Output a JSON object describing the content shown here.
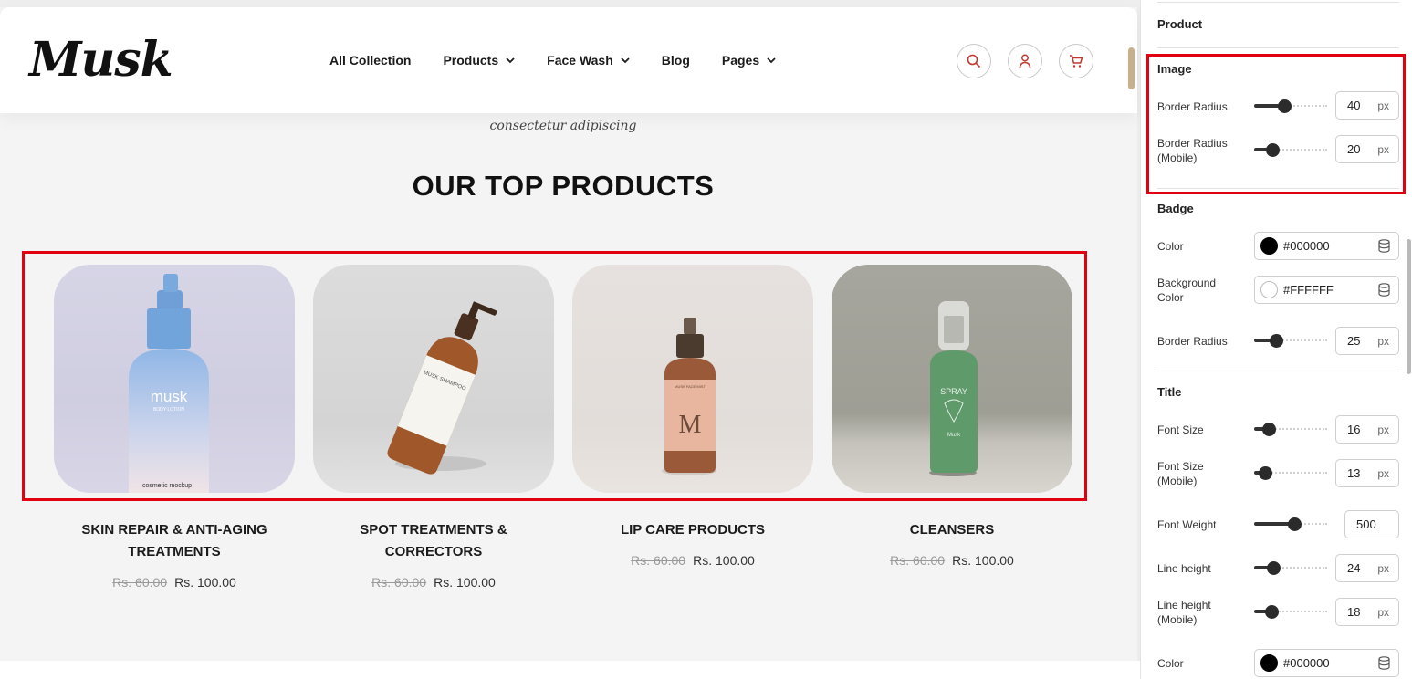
{
  "site": {
    "logo": "Musk",
    "nav": [
      {
        "label": "All Collection",
        "dropdown": false
      },
      {
        "label": "Products",
        "dropdown": true
      },
      {
        "label": "Face Wash",
        "dropdown": true
      },
      {
        "label": "Blog",
        "dropdown": false
      },
      {
        "label": "Pages",
        "dropdown": true
      }
    ],
    "header_icons": [
      "search-icon",
      "user-icon",
      "cart-icon"
    ],
    "tagline": "consectetur adipiscing",
    "section_title": "OUR TOP PRODUCTS",
    "products": [
      {
        "title_line1": "SKIN REPAIR & ANTI-AGING",
        "title_line2": "TREATMENTS",
        "old_price": "Rs. 60.00",
        "new_price": "Rs. 100.00",
        "bottle_text": "musk",
        "bottle_sub": "BODY LOTION",
        "bottle_label": "cosmetic mockup"
      },
      {
        "title_line1": "SPOT TREATMENTS &",
        "title_line2": "CORRECTORS",
        "old_price": "Rs. 60.00",
        "new_price": "Rs. 100.00",
        "bottle_text": "MUSK SHAMPOO"
      },
      {
        "title_line1": "LIP CARE PRODUCTS",
        "title_line2": "",
        "old_price": "Rs. 60.00",
        "new_price": "Rs. 100.00",
        "bottle_text": "M",
        "bottle_sub": "MUSK FACE MIST"
      },
      {
        "title_line1": "CLEANSERS",
        "title_line2": "",
        "old_price": "Rs. 60.00",
        "new_price": "Rs. 100.00",
        "bottle_text": "SPRAY",
        "bottle_sub": "Musk"
      }
    ]
  },
  "panel": {
    "product_heading": "Product",
    "image": {
      "heading": "Image",
      "border_radius_label": "Border Radius",
      "border_radius_value": "40",
      "border_radius_mobile_label_1": "Border Radius",
      "border_radius_mobile_label_2": "(Mobile)",
      "border_radius_mobile_value": "20"
    },
    "badge": {
      "heading": "Badge",
      "color_label": "Color",
      "color_value": "#000000",
      "bg_label_1": "Background",
      "bg_label_2": "Color",
      "bg_value": "#FFFFFF",
      "border_radius_label": "Border Radius",
      "border_radius_value": "25"
    },
    "title": {
      "heading": "Title",
      "font_size_label": "Font Size",
      "font_size_value": "16",
      "font_size_mobile_label_1": "Font Size",
      "font_size_mobile_label_2": "(Mobile)",
      "font_size_mobile_value": "13",
      "font_weight_label": "Font Weight",
      "font_weight_value": "500",
      "line_height_label": "Line height",
      "line_height_value": "24",
      "line_height_mobile_label_1": "Line height",
      "line_height_mobile_label_2": "(Mobile)",
      "line_height_mobile_value": "18",
      "color_label": "Color",
      "color_value": "#000000"
    },
    "unit": "px",
    "slider_levels": {
      "image_border_radius": 0.42,
      "image_border_radius_mobile": 0.25,
      "badge_border_radius": 0.3,
      "title_font_size": 0.2,
      "title_font_size_mobile": 0.16,
      "title_font_weight": 0.56,
      "title_line_height": 0.27,
      "title_line_height_mobile": 0.24
    }
  }
}
